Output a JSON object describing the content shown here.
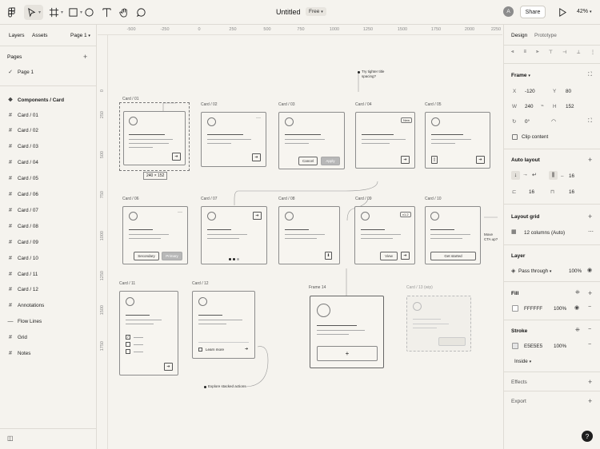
{
  "topbar": {
    "title": "Untitled",
    "plan_badge": "Free",
    "avatar_letter": "A",
    "share_label": "Share",
    "zoom": "42%",
    "icons": [
      "main-menu-icon",
      "move-tool-icon",
      "frame-tool-icon",
      "shape-tool-icon",
      "ellipse-tool-icon",
      "text-tool-icon",
      "hand-tool-icon",
      "comment-tool-icon",
      "play-icon"
    ]
  },
  "left_panel": {
    "tabs": [
      "Layers",
      "Assets"
    ],
    "page_select": "Page 1",
    "pages_header": "Pages",
    "current_page": "Page 1",
    "section_title": "Components / Card",
    "layers": [
      "Card / 01",
      "Card / 02",
      "Card / 03",
      "Card / 04",
      "Card / 05",
      "Card / 06",
      "Card / 07",
      "Card / 08",
      "Card / 09",
      "Card / 10",
      "Card / 11",
      "Card / 12",
      "Annotations",
      "Flow Lines",
      "Grid",
      "Notes"
    ]
  },
  "canvas": {
    "ruler_top": [
      "-500",
      "-250",
      "0",
      "250",
      "500",
      "750",
      "1000",
      "1250",
      "1500",
      "1750",
      "2000",
      "2250"
    ],
    "ruler_left": [
      "0",
      "250",
      "500",
      "750",
      "1000",
      "1250",
      "1500",
      "1750"
    ],
    "card_labels": [
      "Card / 01",
      "Card / 02",
      "Card / 03",
      "Card / 04",
      "Card / 05",
      "Card / 06",
      "Card / 07",
      "Card / 08",
      "Card / 09",
      "Card / 10",
      "Card / 11",
      "Card / 12",
      "Frame 14",
      "Card / 13 (wip)"
    ],
    "selection_size": "240 × 152",
    "cancel": "Cancel",
    "apply": "Apply",
    "new_tag": "New",
    "secondary": "Secondary",
    "primary": "Primary",
    "view": "View",
    "v2_tag": "v1.2",
    "get_started": "Get started",
    "learn_more": "Learn more",
    "note_spacing": "Try tighter title spacing?",
    "note_move_cta": "Move CTA up?",
    "note_stacked": "Explore stacked actions"
  },
  "right_panel": {
    "tabs": [
      "Design",
      "Prototype"
    ],
    "frame_header": "Frame",
    "x_label": "X",
    "x": "-120",
    "y_label": "Y",
    "y": "80",
    "w_label": "W",
    "w": "240",
    "h_label": "H",
    "h": "152",
    "rotation": "0°",
    "clip_content": "Clip content",
    "auto_layout_header": "Auto layout",
    "gap": "16",
    "padding_h": "16",
    "padding_v": "16",
    "layout_grid_header": "Layout grid",
    "grid_value": "12 columns (Auto)",
    "layer_header": "Layer",
    "blend_mode": "Pass through",
    "layer_opacity": "100%",
    "fill_header": "Fill",
    "fill_hex": "FFFFFF",
    "fill_opacity": "100%",
    "stroke_header": "Stroke",
    "stroke_hex": "E5E5E5",
    "stroke_opacity": "100%",
    "stroke_position": "Inside",
    "effects_header": "Effects",
    "export_header": "Export",
    "fill_color": "#FFFFFF",
    "stroke_color": "#E5E5E5"
  },
  "help_label": "?"
}
